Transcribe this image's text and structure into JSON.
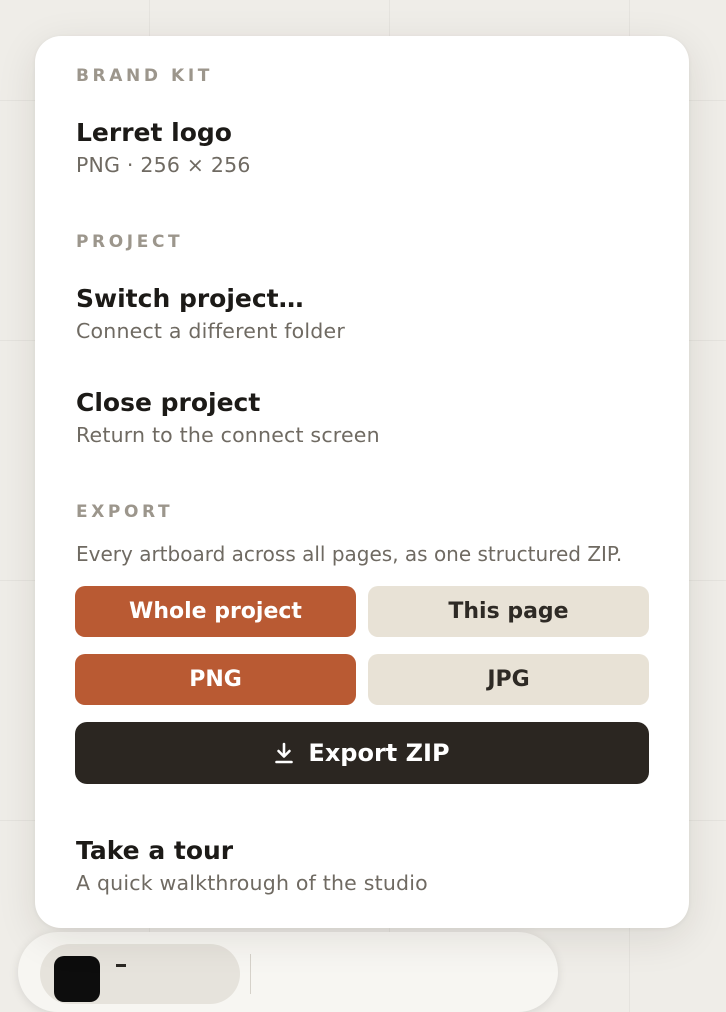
{
  "menu": {
    "brand_kit": {
      "heading": "BRAND KIT",
      "logo_title": "Lerret logo",
      "logo_meta": "PNG · 256 × 256"
    },
    "project": {
      "heading": "PROJECT",
      "switch_title": "Switch project…",
      "switch_sub": "Connect a different folder",
      "close_title": "Close project",
      "close_sub": "Return to the connect screen"
    },
    "export": {
      "heading": "EXPORT",
      "description": "Every artboard across all pages, as one structured ZIP.",
      "scope_options": [
        "Whole project",
        "This page"
      ],
      "scope_selected": "Whole project",
      "format_options": [
        "PNG",
        "JPG"
      ],
      "format_selected": "PNG",
      "export_button_label": "Export ZIP",
      "export_button_icon": "download-icon"
    },
    "tour": {
      "title": "Take a tour",
      "sub": "A quick walkthrough of the studio"
    }
  },
  "colors": {
    "accent": "#b95a33",
    "inactive_segment": "#e8e2d6",
    "primary_button": "#2b2621",
    "section_label": "#9c968c",
    "subtext": "#6f6a62"
  }
}
